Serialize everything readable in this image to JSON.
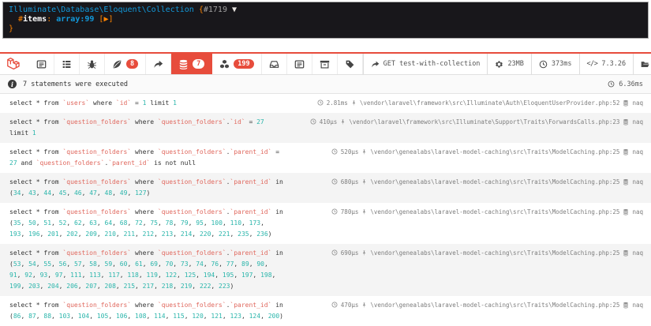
{
  "colors": {
    "accent": "#e74c3c",
    "sql_identifier": "#e0685e",
    "sql_number": "#2ab5ab",
    "dump_bg": "#18171b",
    "dump_class": "#1299da",
    "dump_punct": "#ff8400",
    "dump_ref": "#a0a0a0"
  },
  "dump": {
    "class_name": "Illuminate\\Database\\Eloquent\\Collection",
    "brace_open": " {",
    "object_ref": "#1719",
    "space": " ",
    "expand_arrow": "▼",
    "indent": "  ",
    "property_hash": "#",
    "property_name": "items",
    "colon": ": ",
    "value_type": "array:99",
    "bracket_open": " [",
    "collapsed_arrow": "▶",
    "bracket_close": "]",
    "brace_close": "}"
  },
  "toolbar": {
    "brand_icon": "laravel-logo-icon",
    "tabs": [
      {
        "id": "messages",
        "icon": "icon-list-alt"
      },
      {
        "id": "timeline",
        "icon": "icon-tasks"
      },
      {
        "id": "exceptions",
        "icon": "icon-bug"
      },
      {
        "id": "views",
        "icon": "icon-leaf",
        "badge": "8"
      },
      {
        "id": "route",
        "icon": "icon-share"
      },
      {
        "id": "queries",
        "icon": "icon-database",
        "badge": "7",
        "active": true
      },
      {
        "id": "models",
        "icon": "icon-cubes",
        "badge": "199"
      },
      {
        "id": "mails",
        "icon": "icon-inbox"
      },
      {
        "id": "gate",
        "icon": "icon-list-alt"
      },
      {
        "id": "session",
        "icon": "icon-archive"
      },
      {
        "id": "request",
        "icon": "icon-tags"
      }
    ],
    "request_summary": {
      "method_path": "GET test-with-collection",
      "memory": "23MB",
      "duration": "373ms",
      "php_icon": "</>",
      "php_version": "7.3.26"
    }
  },
  "statements_bar": {
    "info_glyph": "i",
    "message": "7 statements were executed",
    "total_duration": "6.36ms"
  },
  "queries": {
    "rows": [
      {
        "sql": "select * from `users` where `id` = 1 limit 1",
        "duration": "2.81ms",
        "file": "\\vendor\\laravel\\framework\\src\\Illuminate\\Auth\\EloquentUserProvider.php:52",
        "connection": "naq"
      },
      {
        "sql": "select * from `question_folders` where `question_folders`.`id` = 27 limit 1",
        "duration": "410μs",
        "file": "\\vendor\\laravel\\framework\\src\\Illuminate\\Support\\Traits\\ForwardsCalls.php:23",
        "connection": "naq"
      },
      {
        "sql": "select * from `question_folders` where `question_folders`.`parent_id` = 27 and `question_folders`.`parent_id` is not null",
        "duration": "520μs",
        "file": "\\vendor\\genealabs\\laravel-model-caching\\src\\Traits\\ModelCaching.php:25",
        "connection": "naq"
      },
      {
        "sql": "select * from `question_folders` where `question_folders`.`parent_id` in (34, 43, 44, 45, 46, 47, 48, 49, 127)",
        "duration": "680μs",
        "file": "\\vendor\\genealabs\\laravel-model-caching\\src\\Traits\\ModelCaching.php:25",
        "connection": "naq"
      },
      {
        "sql": "select * from `question_folders` where `question_folders`.`parent_id` in (35, 50, 51, 52, 62, 63, 64, 68, 72, 75, 78, 79, 95, 100, 110, 173, 193, 196, 201, 202, 209, 210, 211, 212, 213, 214, 220, 221, 235, 236)",
        "duration": "780μs",
        "file": "\\vendor\\genealabs\\laravel-model-caching\\src\\Traits\\ModelCaching.php:25",
        "connection": "naq"
      },
      {
        "sql": "select * from `question_folders` where `question_folders`.`parent_id` in (53, 54, 55, 56, 57, 58, 59, 60, 61, 69, 70, 73, 74, 76, 77, 89, 90, 91, 92, 93, 97, 111, 113, 117, 118, 119, 122, 125, 194, 195, 197, 198, 199, 203, 204, 206, 207, 208, 215, 217, 218, 219, 222, 223)",
        "duration": "690μs",
        "file": "\\vendor\\genealabs\\laravel-model-caching\\src\\Traits\\ModelCaching.php:25",
        "connection": "naq"
      },
      {
        "sql": "select * from `question_folders` where `question_folders`.`parent_id` in (86, 87, 88, 103, 104, 105, 106, 108, 114, 115, 120, 121, 123, 124, 200)",
        "duration": "470μs",
        "file": "\\vendor\\genealabs\\laravel-model-caching\\src\\Traits\\ModelCaching.php:25",
        "connection": "naq"
      }
    ]
  }
}
